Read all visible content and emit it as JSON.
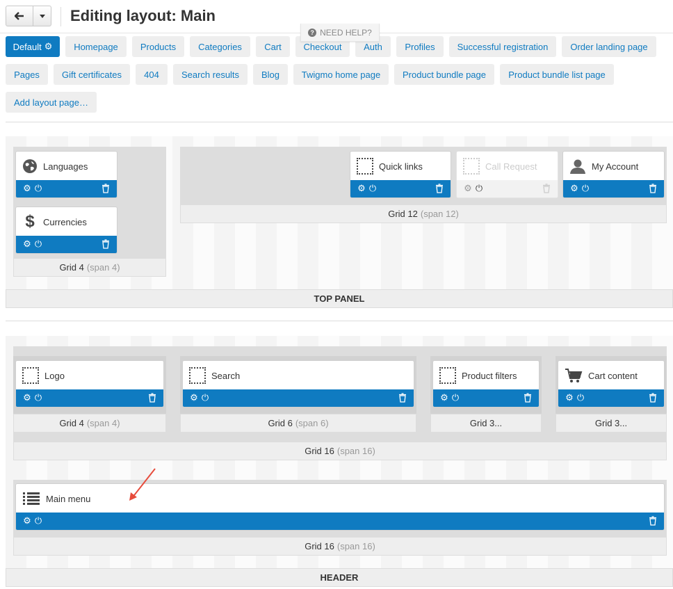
{
  "header": {
    "back_icon": "arrow-left-icon",
    "title": "Editing layout: Main",
    "need_help": "NEED HELP?"
  },
  "tabs": [
    {
      "label": "Default",
      "active": true
    },
    {
      "label": "Homepage"
    },
    {
      "label": "Products"
    },
    {
      "label": "Categories"
    },
    {
      "label": "Cart"
    },
    {
      "label": "Checkout"
    },
    {
      "label": "Auth"
    },
    {
      "label": "Profiles"
    },
    {
      "label": "Successful registration"
    },
    {
      "label": "Order landing page"
    },
    {
      "label": "Pages"
    },
    {
      "label": "Gift certificates"
    },
    {
      "label": "404"
    },
    {
      "label": "Search results"
    },
    {
      "label": "Blog"
    },
    {
      "label": "Twigmo home page"
    },
    {
      "label": "Product bundle page"
    },
    {
      "label": "Product bundle list page"
    },
    {
      "label": "Add layout page…"
    }
  ],
  "top_panel": {
    "label": "TOP PANEL",
    "grids": [
      {
        "name": "Grid 4",
        "span": "(span 4)",
        "blocks": [
          {
            "name": "Languages",
            "icon": "globe-icon"
          },
          {
            "name": "Currencies",
            "icon": "dollar-icon"
          }
        ]
      },
      {
        "name": "Grid 12",
        "span": "(span 12)",
        "blocks": [
          {
            "name": "Quick links",
            "icon": "placeholder-icon"
          },
          {
            "name": "Call Request",
            "icon": "placeholder-icon",
            "disabled": true
          },
          {
            "name": "My Account",
            "icon": "user-icon"
          }
        ]
      }
    ]
  },
  "header_section": {
    "label": "HEADER",
    "grids": [
      {
        "name": "Grid 4",
        "span": "(span 4)",
        "blocks": [
          {
            "name": "Logo",
            "icon": "placeholder-icon"
          }
        ]
      },
      {
        "name": "Grid 6",
        "span": "(span 6)",
        "blocks": [
          {
            "name": "Search",
            "icon": "placeholder-icon"
          }
        ]
      },
      {
        "name": "Grid 3...",
        "span": "",
        "blocks": [
          {
            "name": "Product filters",
            "icon": "placeholder-icon"
          }
        ]
      },
      {
        "name": "Grid 3...",
        "span": "",
        "blocks": [
          {
            "name": "Cart content",
            "icon": "cart-icon"
          }
        ]
      },
      {
        "name": "Grid 16",
        "span": "(span 16)"
      },
      {
        "name": "Grid 16",
        "span": "(span 16)",
        "blocks": [
          {
            "name": "Main menu",
            "icon": "list-icon"
          }
        ]
      }
    ]
  },
  "colors": {
    "accent": "#0f7bc1",
    "tab_bg": "#eeeeee",
    "grid_bg": "#dddddd",
    "annotation_arrow": "#e74c3c"
  }
}
